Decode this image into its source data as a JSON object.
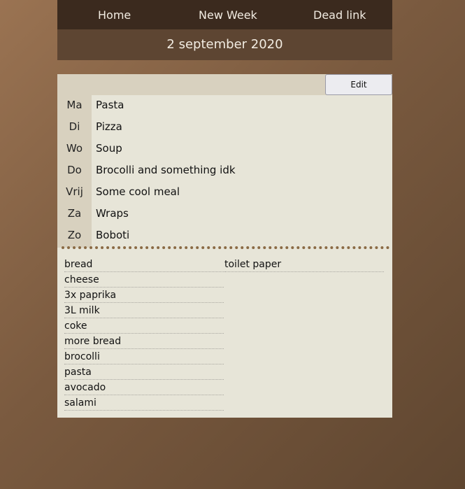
{
  "nav": {
    "items": [
      {
        "label": "Home"
      },
      {
        "label": "New Week"
      },
      {
        "label": "Dead link"
      }
    ]
  },
  "date": "2 september 2020",
  "edit_label": "Edit",
  "week": [
    {
      "day": "Ma",
      "meal": "Pasta"
    },
    {
      "day": "Di",
      "meal": "Pizza"
    },
    {
      "day": "Wo",
      "meal": "Soup"
    },
    {
      "day": "Do",
      "meal": "Brocolli and something idk"
    },
    {
      "day": "Vrij",
      "meal": "Some cool meal"
    },
    {
      "day": "Za",
      "meal": "Wraps"
    },
    {
      "day": "Zo",
      "meal": "Boboti"
    }
  ],
  "shopping_list": {
    "col1": [
      "bread",
      "cheese",
      "3x paprika",
      "3L milk",
      "coke",
      "more bread",
      "brocolli",
      "pasta",
      "avocado",
      "salami"
    ],
    "col2": [
      "toilet paper"
    ]
  }
}
